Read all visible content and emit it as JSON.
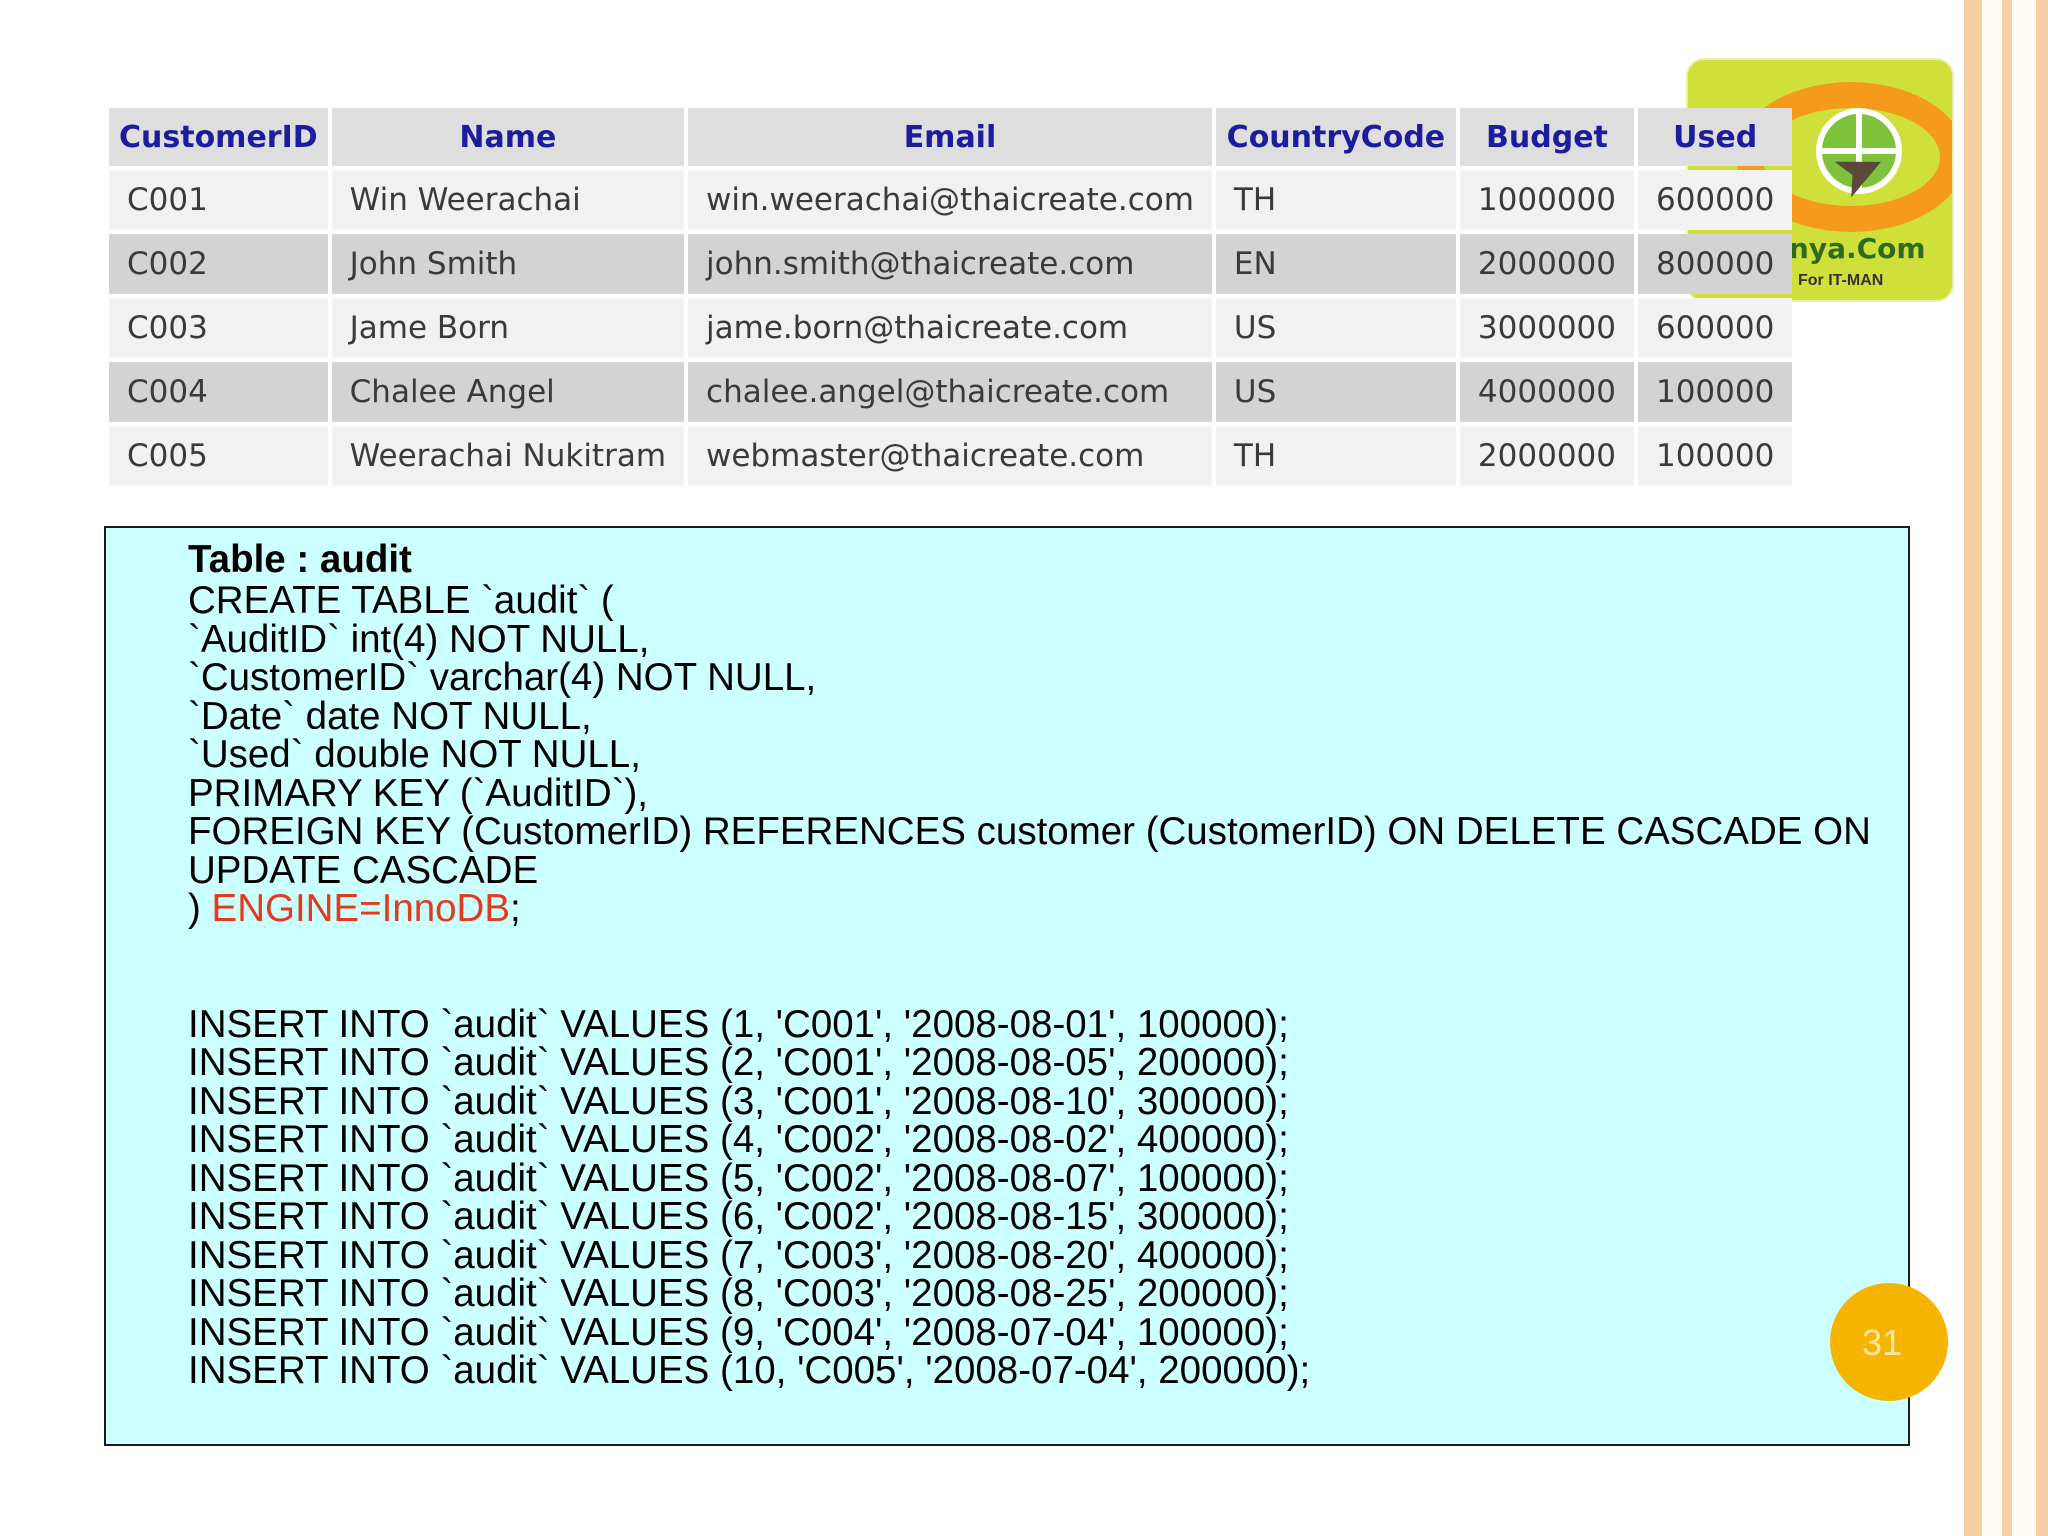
{
  "logo": {
    "brand": "anya.Com",
    "tagline": "For IT-MAN"
  },
  "customer_table": {
    "headers": [
      "CustomerID",
      "Name",
      "Email",
      "CountryCode",
      "Budget",
      "Used"
    ],
    "rows": [
      [
        "C001",
        "Win Weerachai",
        "win.weerachai@thaicreate.com",
        "TH",
        "1000000",
        "600000"
      ],
      [
        "C002",
        "John  Smith",
        "john.smith@thaicreate.com",
        "EN",
        "2000000",
        "800000"
      ],
      [
        "C003",
        "Jame Born",
        "jame.born@thaicreate.com",
        "US",
        "3000000",
        "600000"
      ],
      [
        "C004",
        "Chalee Angel",
        "chalee.angel@thaicreate.com",
        "US",
        "4000000",
        "100000"
      ],
      [
        "C005",
        "Weerachai Nukitram",
        "webmaster@thaicreate.com",
        "TH",
        "2000000",
        "100000"
      ]
    ]
  },
  "code": {
    "title": "Table : audit",
    "create_lines": [
      "CREATE TABLE `audit` (",
      "`AuditID` int(4) NOT NULL,",
      "`CustomerID` varchar(4) NOT NULL,",
      "`Date` date NOT NULL,",
      "`Used` double NOT NULL,",
      "PRIMARY KEY (`AuditID`),",
      "FOREIGN KEY (CustomerID) REFERENCES customer (CustomerID) ON DELETE CASCADE ON UPDATE CASCADE"
    ],
    "closing_prefix": ") ",
    "engine": "ENGINE=InnoDB",
    "closing_suffix": ";",
    "insert_lines": [
      "INSERT INTO `audit` VALUES (1, 'C001', '2008-08-01', 100000);",
      "INSERT INTO `audit` VALUES (2, 'C001', '2008-08-05', 200000);",
      "INSERT INTO `audit` VALUES (3, 'C001', '2008-08-10', 300000);",
      "INSERT INTO `audit` VALUES (4, 'C002', '2008-08-02', 400000);",
      "INSERT INTO `audit` VALUES (5, 'C002', '2008-08-07', 100000);",
      "INSERT INTO `audit` VALUES (6, 'C002', '2008-08-15', 300000);",
      "INSERT INTO `audit` VALUES (7, 'C003', '2008-08-20', 400000);",
      "INSERT INTO `audit` VALUES (8, 'C003', '2008-08-25', 200000);",
      "INSERT INTO `audit` VALUES (9, 'C004', '2008-07-04', 100000);",
      "INSERT INTO `audit` VALUES (10, 'C005', '2008-07-04', 200000);"
    ]
  },
  "page_number": "31",
  "colors": {
    "code_background": "#ccffff",
    "engine_text": "#e4391b",
    "header_text": "#1c1c9c",
    "page_circle": "#f4b400"
  }
}
